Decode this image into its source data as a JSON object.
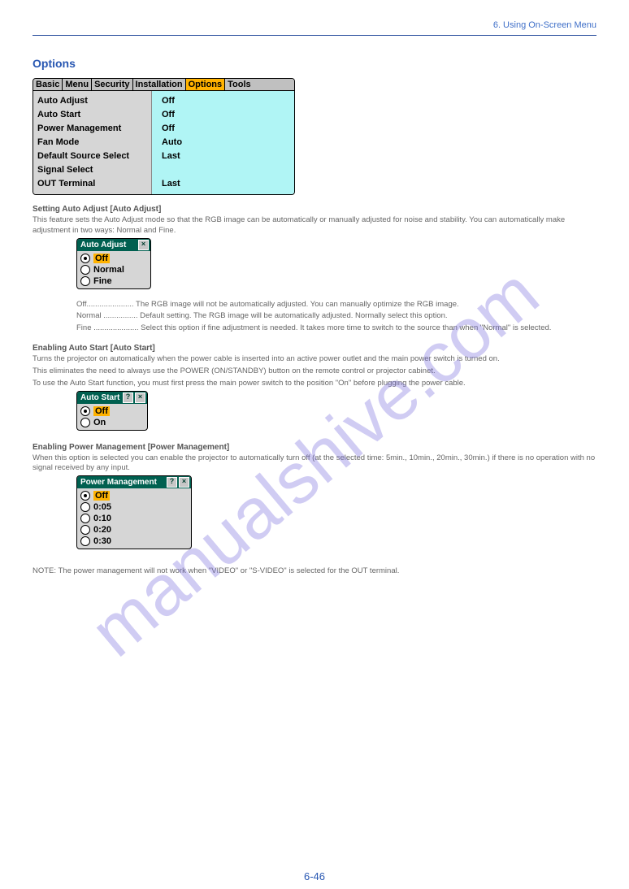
{
  "header_right": "6. Using On-Screen Menu",
  "watermark": "manualshive.com",
  "footer": "6-46",
  "panel": {
    "tabs": [
      "Basic",
      "Menu",
      "Security",
      "Installation",
      "Options",
      "Tools"
    ],
    "active_tab": "Options",
    "rows": [
      {
        "label": "Auto Adjust",
        "value": "Off"
      },
      {
        "label": "Auto Start",
        "value": "Off"
      },
      {
        "label": "Power Management",
        "value": "Off"
      },
      {
        "label": "Fan Mode",
        "value": "Auto"
      },
      {
        "label": "Default Source Select",
        "value": "Last"
      },
      {
        "label": "Signal Select",
        "value": ""
      },
      {
        "label": "OUT Terminal",
        "value": "Last"
      }
    ]
  },
  "sections": {
    "title": "Options",
    "auto_adjust_title": "Setting Auto Adjust [Auto Adjust]",
    "auto_adjust_text": "This feature sets the Auto Adjust mode so that the RGB image can be automatically or manually adjusted for noise and stability. You can automatically make adjustment in two ways: Normal and Fine.",
    "off_text": "Off...................... The RGB image will not be automatically adjusted. You can manually optimize the RGB image.",
    "normal_text": "Normal ................ Default setting. The RGB image will be automatically adjusted. Normally select this option.",
    "fine_text": "Fine ..................... Select this option if fine adjustment is needed. It takes more time to switch to the source than when \"Normal\" is selected.",
    "auto_start_title": "Enabling Auto Start [Auto Start]",
    "auto_start_text1": "Turns the projector on automatically when the power cable is inserted into an active power outlet and the main power switch is turned on.",
    "auto_start_text2": "This eliminates the need to always use the POWER (ON/STANDBY) button on the remote control or projector cabinet.",
    "auto_start_text3": "To use the Auto Start function, you must first press the main power switch to the position \"On\" before plugging the power cable.",
    "pm_title": "Enabling Power Management [Power Management]",
    "pm_text1": "When this option is selected you can enable the projector to automatically turn off (at the selected time: 5min., 10min., 20min., 30min.) if there is no operation with no signal received by any input.",
    "pm_note": "NOTE: The power management will not work when \"VIDEO\" or \"S-VIDEO\" is selected for the OUT terminal."
  },
  "dlg_auto_adjust": {
    "title": "Auto Adjust",
    "items": [
      "Off",
      "Normal",
      "Fine"
    ],
    "selected": "Off"
  },
  "dlg_auto_start": {
    "title": "Auto Start",
    "items": [
      "Off",
      "On"
    ],
    "selected": "Off"
  },
  "dlg_pm": {
    "title": "Power Management",
    "items": [
      "Off",
      "0:05",
      "0:10",
      "0:20",
      "0:30"
    ],
    "selected": "Off"
  }
}
